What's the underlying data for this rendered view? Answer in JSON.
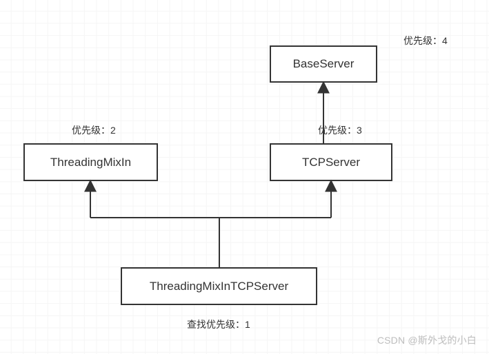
{
  "nodes": {
    "base": {
      "label": "BaseServer"
    },
    "mixin": {
      "label": "ThreadingMixIn"
    },
    "tcp": {
      "label": "TCPServer"
    },
    "combined": {
      "label": "ThreadingMixInTCPServer"
    }
  },
  "labels": {
    "priority2": "优先级：2",
    "priority3": "优先级：3",
    "priority4": "优先级：4",
    "bottom": "查找优先级：1"
  },
  "watermark": "CSDN @斯外戈的小白"
}
